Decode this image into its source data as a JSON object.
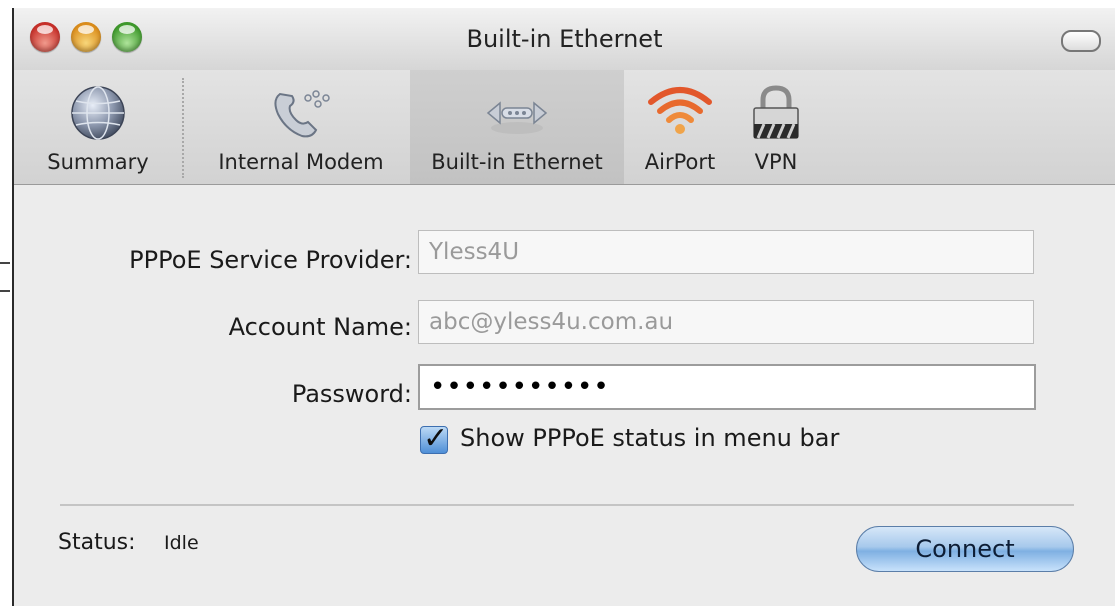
{
  "window": {
    "title": "Built-in Ethernet"
  },
  "toolbar": {
    "items": [
      {
        "label": "Summary",
        "icon": "globe-icon"
      },
      {
        "label": "Internal Modem",
        "icon": "phone-icon"
      },
      {
        "label": "Built-in Ethernet",
        "icon": "ethernet-icon",
        "selected": true
      },
      {
        "label": "AirPort",
        "icon": "wifi-icon"
      },
      {
        "label": "VPN",
        "icon": "padlock-icon"
      }
    ]
  },
  "form": {
    "provider_label": "PPPoE Service Provider:",
    "provider_value": "Yless4U",
    "account_label": "Account Name:",
    "account_value": "abc@yless4u.com.au",
    "password_label": "Password:",
    "password_value": "•••••••••••",
    "show_status_checked": true,
    "show_status_label": "Show PPPoE status in menu bar"
  },
  "footer": {
    "status_label": "Status:",
    "status_value": "Idle",
    "connect_label": "Connect"
  },
  "colors": {
    "accent": "#7fb0e2",
    "airport": "#e2572b",
    "window_bg": "#ececec"
  }
}
